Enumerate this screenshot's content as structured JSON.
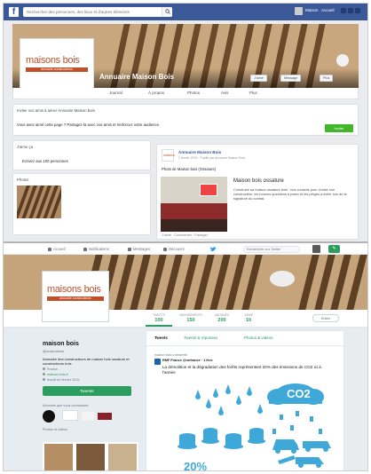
{
  "facebook": {
    "search": {
      "placeholder": "Rechercher des personnes, des lieux et d'autres éléments"
    },
    "top_nav": {
      "user": "Maison",
      "home": "Accueil"
    },
    "page_name": "Annuaire Maison Bois",
    "cover_buttons": [
      "J'aime",
      "Message",
      "Plus"
    ],
    "tabs": [
      "Journal",
      "À propos",
      "Photos",
      "Avis",
      "Plus"
    ],
    "invite_card": {
      "header": "Inviter vos amis à aimer Annuaire Maison Bois",
      "text": "Vous avez aimé cette page ? Partagez-la avec vos amis et renforcez votre audience.",
      "button": "Inviter"
    },
    "likes_card": {
      "header": "J'aime ça",
      "text": "Ecrivez aux 100 personnes"
    },
    "photos_card": {
      "header": "Photos"
    },
    "post": {
      "author": "Annuaire Maison Bois",
      "meta": "1 février 2015 · Publié par Annuaire Maison Bois",
      "subtitle": "Photo de Maison bois (Ossature)",
      "link_title": "Maison bois ossature",
      "link_text": "Construire sa maison ossature bois : nos conseils pour choisir son constructeur, les bonnes questions à poser et les pièges à éviter lors de la signature du contrat.",
      "actions": "J'aime · Commenter · Partager"
    }
  },
  "twitter": {
    "nav": [
      "Accueil",
      "Notifications",
      "Messages",
      "Découvrir"
    ],
    "search_placeholder": "Rechercher sur Twitter",
    "stats": [
      {
        "label": "TWEETS",
        "value": "100"
      },
      {
        "label": "ABONNEMENTS",
        "value": "150"
      },
      {
        "label": "ABONNÉS",
        "value": "200"
      },
      {
        "label": "J'AIME",
        "value": "10"
      }
    ],
    "follow_button": "Éditer",
    "profile": {
      "name": "maison bois",
      "handle": "@maisonbois",
      "bio": "Annuaire des constructeurs de maison bois ossature et constructeurs bois",
      "location": "France",
      "website": "maison-bois.fr",
      "joined": "Inscrit en février 2015"
    },
    "left_button": "Tweeter",
    "followers_you_know": "Abonnés que vous connaissez",
    "media_label": "Photos et vidéos",
    "tabs": [
      "Tweets",
      "Tweets & réponses",
      "Photos & vidéos"
    ],
    "tweet": {
      "context": "maison bois a retweeté",
      "author": "RMF France @rmfrance · 1 févr.",
      "text": "La démolition et la dégradation des forêts représentent 20% des émissions de CO2 ici à l'année"
    },
    "infographic": {
      "label": "CO2",
      "percent": "20%"
    }
  },
  "colors": {
    "fb_blue": "#3b5998",
    "tw_green": "#2b9d5f",
    "brand_orange": "#c0502a",
    "fb_green": "#42b72a",
    "infographic_blue": "#3ea8d8"
  },
  "brand": {
    "logo_word": "maisons bois",
    "logo_tagline": "annuaire constructeurs"
  }
}
